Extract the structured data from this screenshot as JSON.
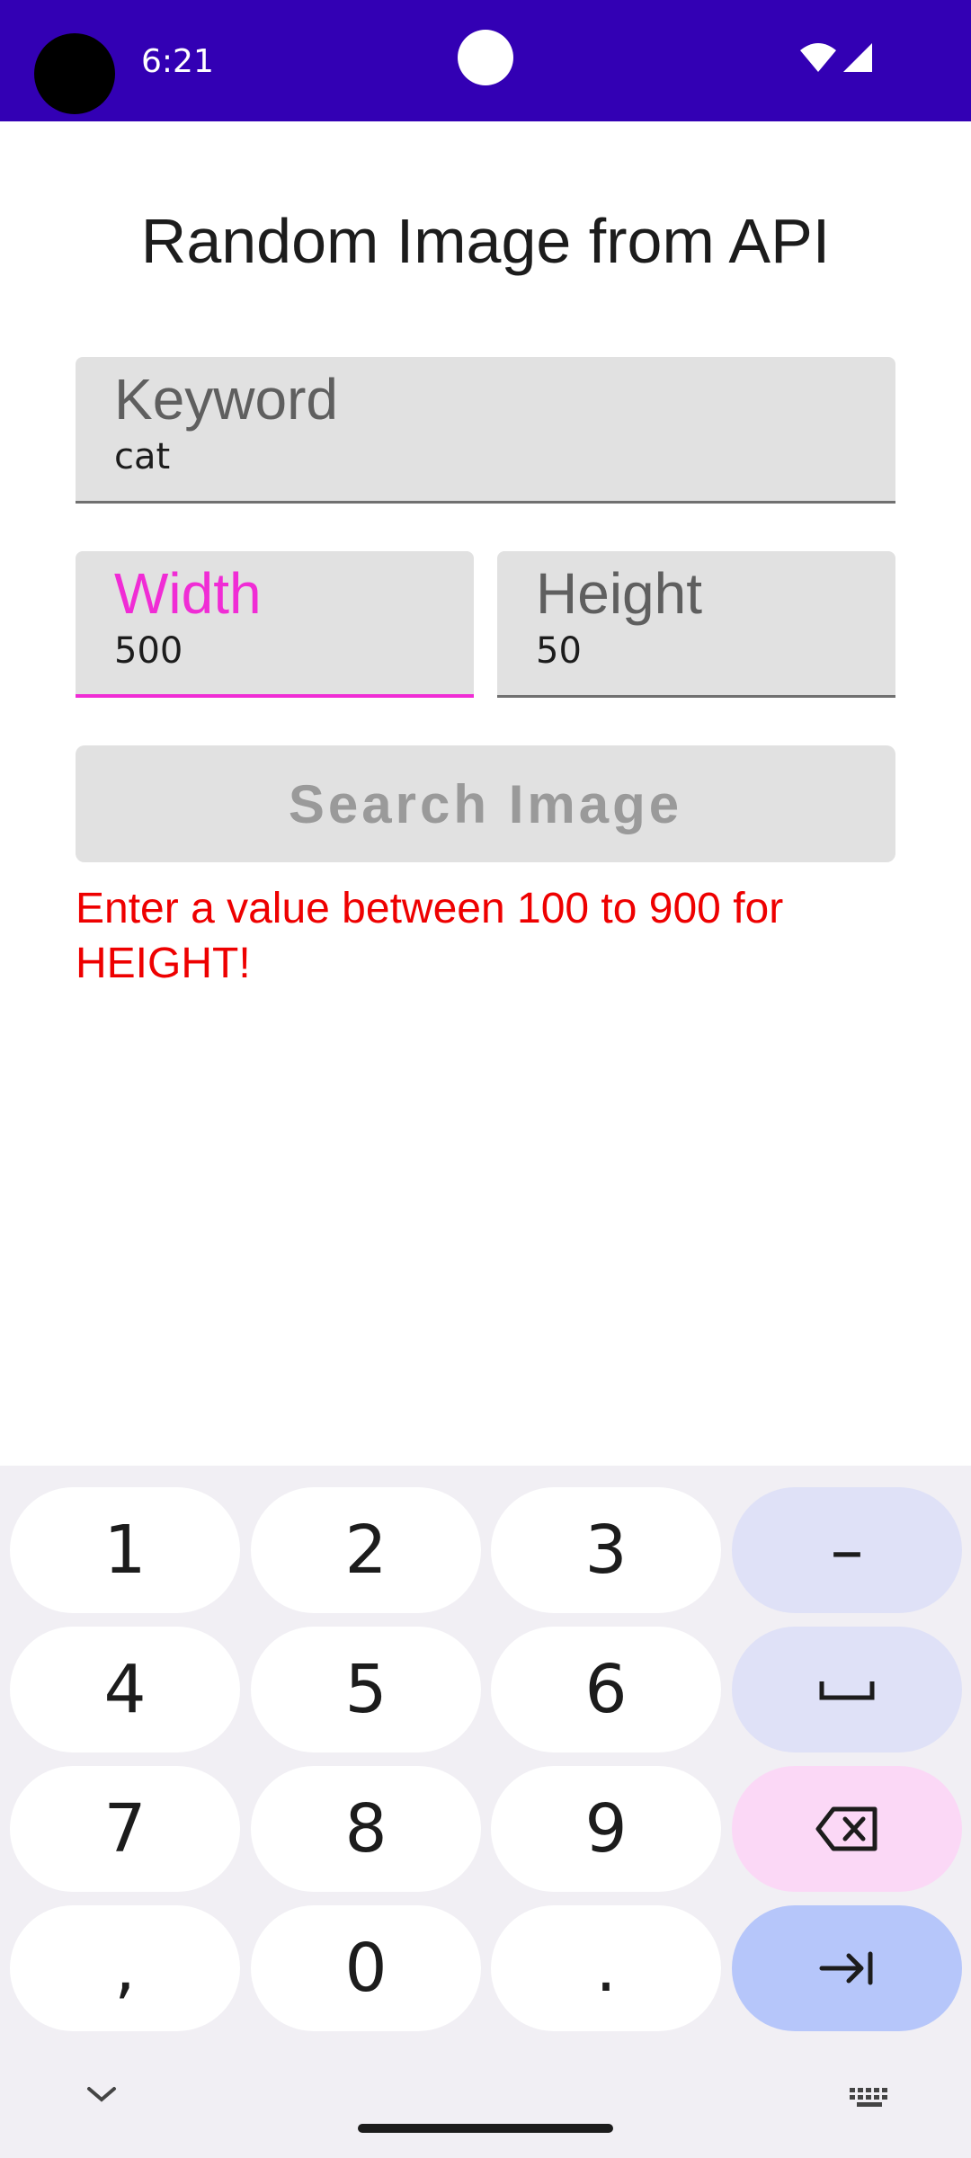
{
  "status_bar": {
    "time": "6:21",
    "background": "#3300b4",
    "icons": [
      "wifi-icon",
      "signal-icon"
    ]
  },
  "page": {
    "title": "Random Image from API"
  },
  "form": {
    "keyword": {
      "label": "Keyword",
      "value": "cat"
    },
    "width": {
      "label": "Width",
      "value": "500",
      "focused": true
    },
    "height": {
      "label": "Height",
      "value": "50"
    },
    "search_button": {
      "label": "Search Image",
      "enabled": false
    },
    "error_message": "Enter a value between 100 to 900 for HEIGHT!"
  },
  "colors": {
    "accent_pink": "#f02cd5",
    "error_red": "#ee0000",
    "field_bg": "#e1e1e1"
  },
  "keyboard": {
    "keys": [
      {
        "label": "1"
      },
      {
        "label": "2"
      },
      {
        "label": "3"
      },
      {
        "label": "–",
        "icon": "minus-icon"
      },
      {
        "label": "4"
      },
      {
        "label": "5"
      },
      {
        "label": "6"
      },
      {
        "label": "",
        "icon": "space-icon"
      },
      {
        "label": "7"
      },
      {
        "label": "8"
      },
      {
        "label": "9"
      },
      {
        "label": "",
        "icon": "backspace-icon"
      },
      {
        "label": ","
      },
      {
        "label": "0"
      },
      {
        "label": "."
      },
      {
        "label": "",
        "icon": "next-field-icon"
      }
    ],
    "bottom_icons": [
      "chevron-down-icon",
      "keyboard-switch-icon"
    ]
  }
}
